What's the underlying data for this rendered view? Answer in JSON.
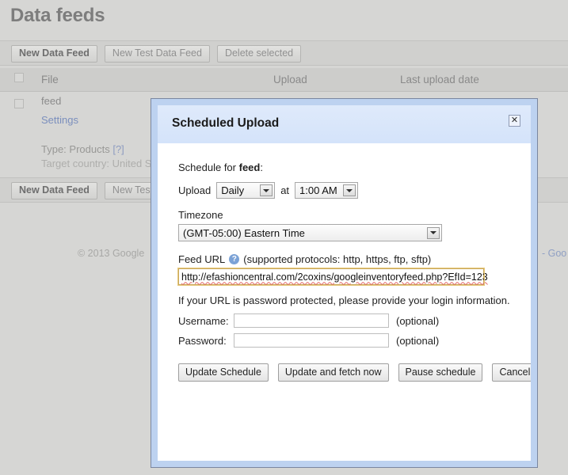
{
  "page": {
    "title": "Data feeds",
    "toolbar": {
      "new_data_feed": "New Data Feed",
      "new_test_data_feed": "New Test Data Feed",
      "delete_selected": "Delete selected"
    },
    "toolbar2": {
      "new_data_feed": "New Data Feed",
      "new_test_data_feed": "New Test"
    },
    "table": {
      "columns": {
        "file": "File",
        "upload": "Upload",
        "last_upload_date": "Last upload date"
      },
      "row": {
        "file": "feed",
        "settings_link": "Settings",
        "type": "Type: Products",
        "type_help": "[?]",
        "target_country": "Target country: United Sta"
      }
    },
    "footer": {
      "copyright": "© 2013 Google",
      "right_link": "- Goo"
    }
  },
  "dialog": {
    "title": "Scheduled Upload",
    "close_label": "✕",
    "schedule_for_prefix": "Schedule for ",
    "schedule_for_name": "feed",
    "schedule_for_suffix": ":",
    "upload_label": "Upload",
    "frequency_value": "Daily",
    "at_label": "at",
    "time_value": "1:00 AM",
    "timezone_label": "Timezone",
    "timezone_value": "(GMT-05:00) Eastern Time",
    "feed_url_label": "Feed URL",
    "help_glyph": "?",
    "protocols_note": "(supported protocols: http, https, ftp, sftp)",
    "feed_url_value": "http://efashioncentral.com/2coxins/googleinventoryfeed.php?EfId=123",
    "password_note": "If your URL is password protected, please provide your login information.",
    "username_label": "Username:",
    "username_value": "",
    "username_optional": "(optional)",
    "password_label": "Password:",
    "password_value": "",
    "password_optional": "(optional)",
    "buttons": {
      "update_schedule": "Update Schedule",
      "update_and_fetch": "Update and fetch now",
      "pause_schedule": "Pause schedule",
      "cancel": "Cancel"
    }
  },
  "colors": {
    "page_bg": "#d6d6d4",
    "dialog_frame": "#bdd2f0",
    "dialog_border": "#7a86a0",
    "titlebar": "#dfeafb",
    "link": "#7b8fbd",
    "url_focus_border": "#c8a85c",
    "spellcheck_underline": "#e06666",
    "help_icon": "#7ba2d6"
  }
}
